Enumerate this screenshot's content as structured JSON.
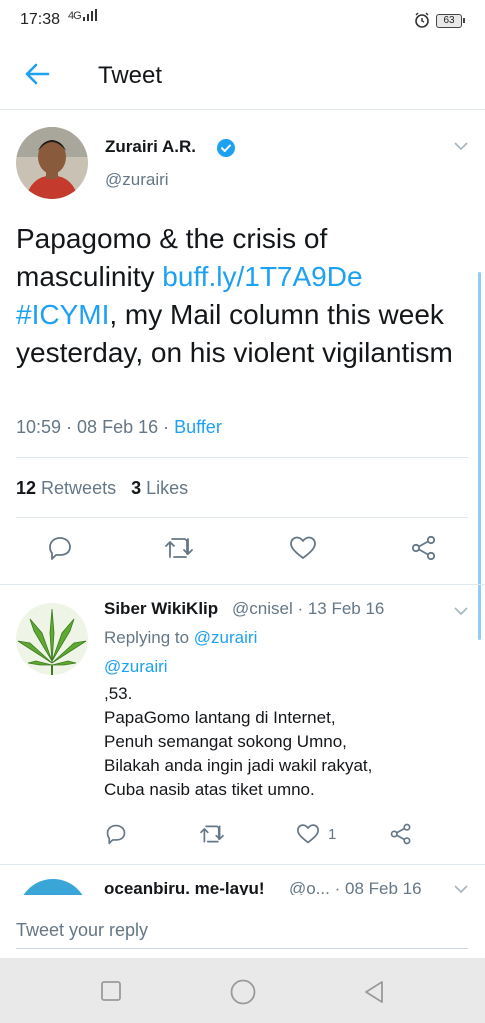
{
  "status_bar": {
    "time": "17:38",
    "network": "4G",
    "battery": "63"
  },
  "header": {
    "title": "Tweet"
  },
  "tweet": {
    "author_name": "Zurairi A.R.",
    "author_handle": "@zurairi",
    "text_part1": "Papagomo & the crisis of masculinity ",
    "link": "buff.ly/1T7A9De",
    "hashtag": "#ICYMI",
    "text_part2": ", my Mail column this week yesterday, on his violent vigilantism",
    "time": "10:59",
    "date": "08 Feb 16",
    "source": "Buffer",
    "retweets_count": "12",
    "retweets_label": "Retweets",
    "likes_count": "3",
    "likes_label": "Likes"
  },
  "reply": {
    "name": "Siber WikiKlip",
    "handle_date": "@cnisel · 13 Feb 16",
    "replying_label": "Replying to",
    "replying_to": "@zurairi",
    "mention": "@zurairi",
    "lines": [
      ",53.",
      "PapaGomo lantang di Internet,",
      "Penuh semangat sokong Umno,",
      "Bilakah anda ingin jadi wakil rakyat,",
      "Cuba nasib atas tiket umno."
    ],
    "like_count": "1"
  },
  "next_reply": {
    "name": "oceanbiru. me-layu!",
    "handle_date": "@o... · 08 Feb 16"
  },
  "compose": {
    "placeholder": "Tweet your reply"
  },
  "colors": {
    "accent": "#1da1f2",
    "secondary_text": "#657786",
    "divider": "#e1e8ed"
  },
  "icons": [
    "back-arrow-icon",
    "verified-icon",
    "chevron-down-icon",
    "reply-icon",
    "retweet-icon",
    "like-icon",
    "share-icon",
    "recent-apps-icon",
    "home-icon",
    "back-triangle-icon"
  ]
}
